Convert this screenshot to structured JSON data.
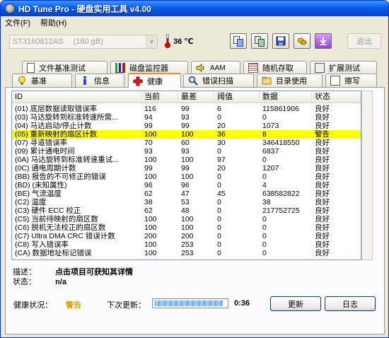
{
  "window": {
    "title": "HD Tune Pro - 硬盘实用工具 v4.00"
  },
  "menu": {
    "items": [
      "文件(F)",
      "帮助(H)"
    ]
  },
  "toolbar": {
    "drive_name": "ST3160812AS",
    "drive_size": "(160 gB)",
    "temperature": "36 ℃",
    "exit_label": "退出",
    "buttons": [
      "copy-text-icon",
      "copy-screenshot-icon",
      "save-icon",
      "options-icon",
      "download-icon"
    ]
  },
  "tabs_top": [
    "文件基准测试",
    "磁盘监控器",
    "AAM",
    "随机存取",
    "扩展测试"
  ],
  "tabs_bottom": [
    "基准",
    "信息",
    "健康",
    "错误扫描",
    "目录使用",
    "擦写"
  ],
  "active_tab": "健康",
  "table": {
    "headers": [
      "ID",
      "当前",
      "最差",
      "阈值",
      "数据",
      "状态"
    ],
    "rows": [
      [
        "(01) 底层数据读取错误率",
        "116",
        "99",
        "6",
        "115861906",
        "良好"
      ],
      [
        "(03) 马达旋转到标准转速所需...",
        "94",
        "93",
        "0",
        "0",
        "良好"
      ],
      [
        "(04) 马达启动/停止计数",
        "99",
        "99",
        "20",
        "1073",
        "良好"
      ],
      [
        "(05) 重新映射的扇区计数",
        "100",
        "100",
        "36",
        "8",
        "警告"
      ],
      [
        "(07) 寻道错误率",
        "70",
        "60",
        "30",
        "346418550",
        "良好"
      ],
      [
        "(09) 累计通电时间",
        "93",
        "93",
        "0",
        "6837",
        "良好"
      ],
      [
        "(0A) 马达旋转到标准转速重试...",
        "100",
        "100",
        "97",
        "0",
        "良好"
      ],
      [
        "(0C) 通电周期计数",
        "99",
        "99",
        "20",
        "1207",
        "良好"
      ],
      [
        "(BB) 报告的不可修正的错误",
        "100",
        "100",
        "0",
        "0",
        "良好"
      ],
      [
        "(BD) (未知属性)",
        "96",
        "96",
        "0",
        "4",
        "良好"
      ],
      [
        "(BE) 气流温度",
        "62",
        "47",
        "45",
        "638582822",
        "良好"
      ],
      [
        "(C2) 温度",
        "38",
        "53",
        "0",
        "38",
        "良好"
      ],
      [
        "(C3) 硬件 ECC 校正",
        "62",
        "48",
        "0",
        "217752725",
        "良好"
      ],
      [
        "(C5) 当前待映射的扇区数",
        "100",
        "100",
        "0",
        "0",
        "良好"
      ],
      [
        "(C6) 脱机无法校正的扇区数",
        "100",
        "100",
        "0",
        "0",
        "良好"
      ],
      [
        "(C7) Ultra DMA CRC 错误计数",
        "200",
        "200",
        "0",
        "0",
        "良好"
      ],
      [
        "(C8) 写入错误率",
        "100",
        "253",
        "0",
        "0",
        "良好"
      ],
      [
        "(CA) 数据地址标记错误",
        "100",
        "253",
        "0",
        "0",
        "良好"
      ]
    ],
    "warning_row_index": 3
  },
  "details": {
    "desc_label": "描述：",
    "desc_value": "点击项目可获知其详情",
    "status_label": "状态：",
    "status_value": "n/a"
  },
  "footer": {
    "health_label": "健康状况：",
    "health_value": "警告",
    "health_color": "#e8a000",
    "next_update_label": "下次更新：",
    "progress_fraction": 0.95,
    "countdown": "0:36",
    "refresh_label": "更新",
    "log_label": "日志"
  }
}
